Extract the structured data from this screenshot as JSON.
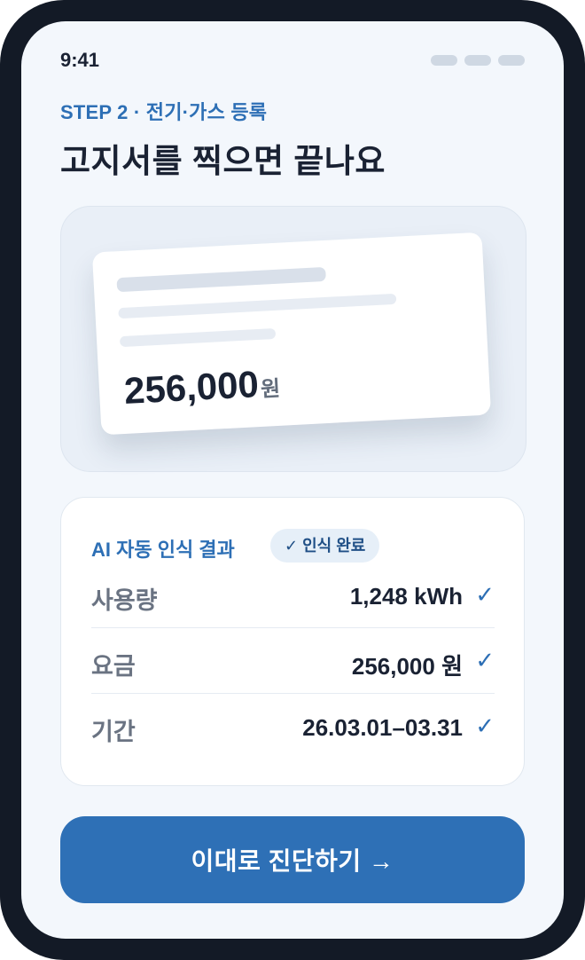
{
  "status_bar": {
    "time": "9:41"
  },
  "header": {
    "step": "STEP 2 · 전기·가스 등록",
    "title": "고지서를 찍으면 끝나요"
  },
  "bill_preview": {
    "amount": "256,000",
    "unit": "원"
  },
  "recognition": {
    "title": "AI 자동 인식 결과",
    "badge": "✓ 인식 완료",
    "rows": [
      {
        "label": "사용량",
        "value": "1,248 kWh",
        "check": "✓"
      },
      {
        "label": "요금",
        "value": "256,000 원",
        "check": "✓"
      },
      {
        "label": "기간",
        "value": "26.03.01–03.31",
        "check": "✓"
      }
    ]
  },
  "cta": {
    "label": "이대로 진단하기 →"
  },
  "colors": {
    "accent": "#2e70b6",
    "frame": "#131a26",
    "background": "#f3f7fc",
    "text": "#1a2233"
  }
}
